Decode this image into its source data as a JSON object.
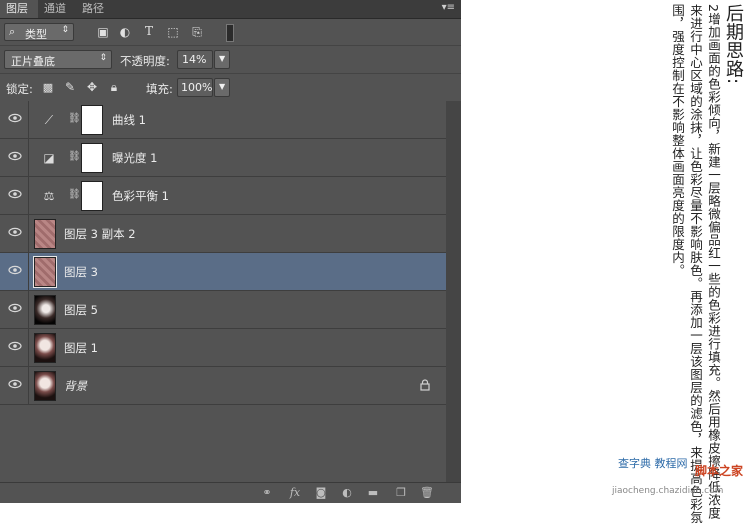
{
  "tabs": [
    {
      "label": "图层",
      "active": true
    },
    {
      "label": "通道",
      "active": false
    },
    {
      "label": "路径",
      "active": false
    }
  ],
  "filter": {
    "label": "类型",
    "icons": [
      "image-filter-icon",
      "adjustment-filter-icon",
      "type-filter-icon",
      "shape-filter-icon",
      "smart-object-filter-icon",
      "filter-toggle-icon"
    ]
  },
  "blend": {
    "mode": "正片叠底",
    "opacity_label": "不透明度:",
    "opacity_value": "14%"
  },
  "lock": {
    "label": "锁定:",
    "fill_label": "填充:",
    "fill_value": "100%"
  },
  "layers": [
    {
      "name": "曲线 1",
      "kind": "adjustment",
      "icon": "curves-icon",
      "selected": false
    },
    {
      "name": "曝光度 1",
      "kind": "adjustment",
      "icon": "exposure-icon",
      "selected": false
    },
    {
      "name": "色彩平衡 1",
      "kind": "adjustment",
      "icon": "color-balance-icon",
      "selected": false
    },
    {
      "name": "图层 3 副本 2",
      "kind": "pixel",
      "thumb": "pink",
      "selected": false
    },
    {
      "name": "图层 3",
      "kind": "pixel",
      "thumb": "pink",
      "selected": true
    },
    {
      "name": "图层 5",
      "kind": "pixel",
      "thumb": "photo2",
      "selected": false
    },
    {
      "name": "图层 1",
      "kind": "pixel",
      "thumb": "photo",
      "selected": false
    },
    {
      "name": "背景",
      "kind": "background",
      "thumb": "photo",
      "selected": false,
      "locked": true
    }
  ],
  "notes": {
    "title": "后期思路:",
    "columns": [
      "2增加画面的色彩倾向，新建一层略微偏品红一些的色彩进行填充。然后用橡皮擦降低浓度",
      "来进行中心区域的涂抹，让色彩尽量不影响肤色。再添加一层该图层的滤色，来提高色彩氛",
      "围，强度控制在不影响整体画面亮度的限度内。"
    ]
  },
  "watermark": {
    "text1": "查字典 教程网",
    "text2": "脚本之家",
    "url": "jiaocheng.chazidian.com"
  },
  "colors": {
    "panel": "#535353",
    "selected": "#5a6d87",
    "tabbar": "#3c3c3c"
  }
}
